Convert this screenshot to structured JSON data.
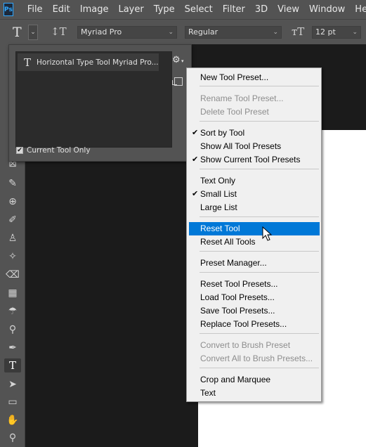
{
  "app": {
    "logo_text": "Ps"
  },
  "menubar": {
    "items": [
      "File",
      "Edit",
      "Image",
      "Layer",
      "Type",
      "Select",
      "Filter",
      "3D",
      "View",
      "Window",
      "Help"
    ]
  },
  "options_bar": {
    "tool_glyph": "T",
    "font_family": "Myriad Pro",
    "font_style": "Regular",
    "font_size": "12 pt"
  },
  "preset_panel": {
    "preset_name": "Horizontal Type Tool Myriad Pro...",
    "current_tool_only_label": "Current Tool Only",
    "current_tool_only_checked": true
  },
  "context_menu": {
    "items": [
      {
        "label": "New Tool Preset...",
        "enabled": true,
        "checked": false
      },
      {
        "label": "Rename Tool Preset...",
        "enabled": false,
        "checked": false
      },
      {
        "label": "Delete Tool Preset",
        "enabled": false,
        "checked": false
      },
      {
        "label": "Sort by Tool",
        "enabled": true,
        "checked": true
      },
      {
        "label": "Show All Tool Presets",
        "enabled": true,
        "checked": false
      },
      {
        "label": "Show Current Tool Presets",
        "enabled": true,
        "checked": true
      },
      {
        "label": "Text Only",
        "enabled": true,
        "checked": false
      },
      {
        "label": "Small List",
        "enabled": true,
        "checked": true
      },
      {
        "label": "Large List",
        "enabled": true,
        "checked": false
      },
      {
        "label": "Reset Tool",
        "enabled": true,
        "checked": false,
        "highlighted": true
      },
      {
        "label": "Reset All Tools",
        "enabled": true,
        "checked": false
      },
      {
        "label": "Preset Manager...",
        "enabled": true,
        "checked": false
      },
      {
        "label": "Reset Tool Presets...",
        "enabled": true,
        "checked": false
      },
      {
        "label": "Load Tool Presets...",
        "enabled": true,
        "checked": false
      },
      {
        "label": "Save Tool Presets...",
        "enabled": true,
        "checked": false
      },
      {
        "label": "Replace Tool Presets...",
        "enabled": true,
        "checked": false
      },
      {
        "label": "Convert to Brush Preset",
        "enabled": false,
        "checked": false
      },
      {
        "label": "Convert All to Brush Presets...",
        "enabled": false,
        "checked": false
      },
      {
        "label": "Crop and Marquee",
        "enabled": true,
        "checked": false
      },
      {
        "label": "Text",
        "enabled": true,
        "checked": false
      }
    ],
    "check_glyph": "✔"
  },
  "toolbar": {
    "active_tool_glyph": "T",
    "icons": [
      "move-icon",
      "marquee-icon",
      "lasso-icon",
      "quick-select-icon",
      "crop-icon",
      "frame-icon",
      "eyedropper-icon",
      "healing-brush-icon",
      "brush-icon",
      "clone-stamp-icon",
      "history-brush-icon",
      "eraser-icon",
      "gradient-icon",
      "blur-icon",
      "dodge-icon",
      "pen-icon",
      "type-tool-icon",
      "path-select-icon",
      "rectangle-icon",
      "hand-icon",
      "zoom-icon"
    ]
  },
  "colors": {
    "chrome": "#535353",
    "canvas_bg": "#1b1b1b",
    "menu_bg": "#f0f0f0",
    "highlight": "#0078d7",
    "ps_brand": "#31a8ff"
  }
}
